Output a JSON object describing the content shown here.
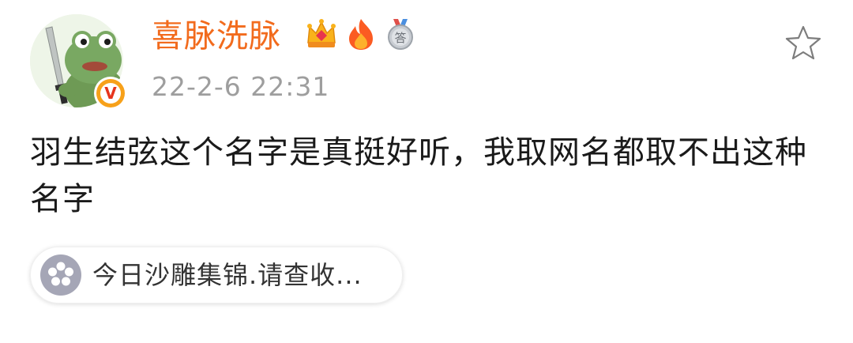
{
  "post": {
    "author": {
      "name": "喜脉洗脉",
      "avatar_icon": "frog-with-sword-avatar",
      "verified_icon": "orange-verified-v-icon",
      "verified_letter": "V",
      "badges": [
        {
          "icon": "crown-vip-badge-icon"
        },
        {
          "icon": "fire-badge-icon"
        },
        {
          "icon": "silver-medal-badge-icon",
          "text": "答"
        }
      ],
      "name_color": "#f26b1d"
    },
    "timestamp": "22-2-6 22:31",
    "content": "羽生结弦这个名字是真挺好听，我取网名都取不出这种名字",
    "topic": {
      "icon": "flower-topic-icon",
      "label": "今日沙雕集锦.请查收..."
    },
    "favorite_icon": "star-outline-icon"
  }
}
